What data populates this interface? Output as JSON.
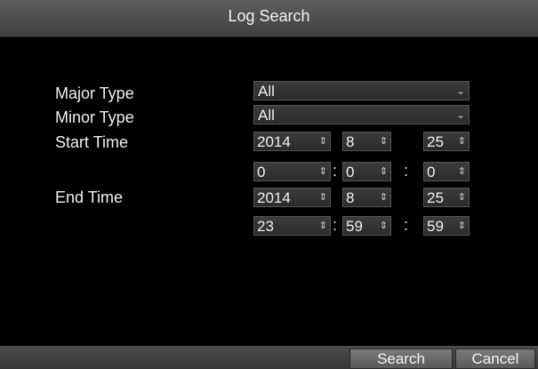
{
  "window": {
    "title": "Log Search"
  },
  "form": {
    "major_type": {
      "label": "Major Type",
      "value": "All"
    },
    "minor_type": {
      "label": "Minor Type",
      "value": "All"
    },
    "start_time": {
      "label": "Start Time",
      "date": {
        "year": "2014",
        "month": "8",
        "day": "25"
      },
      "time": {
        "hour": "0",
        "minute": "0",
        "second": "0"
      }
    },
    "end_time": {
      "label": "End Time",
      "date": {
        "year": "2014",
        "month": "8",
        "day": "25"
      },
      "time": {
        "hour": "23",
        "minute": "59",
        "second": "59"
      }
    },
    "time_separator": ":"
  },
  "icons": {
    "dropdown": "chevron-down-icon",
    "spinner": "updown-spinner-icon"
  },
  "buttons": {
    "search": "Search",
    "cancel": "Cancel"
  }
}
